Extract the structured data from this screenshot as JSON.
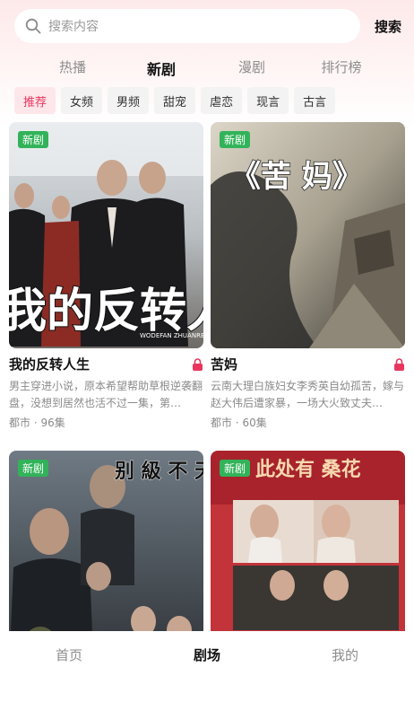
{
  "search": {
    "placeholder": "搜索内容",
    "button_label": "搜索"
  },
  "tabs": [
    {
      "label": "热播"
    },
    {
      "label": "新剧"
    },
    {
      "label": "漫剧"
    },
    {
      "label": "排行榜"
    }
  ],
  "active_tab": "新剧",
  "chips": [
    {
      "label": "推荐"
    },
    {
      "label": "女频"
    },
    {
      "label": "男频"
    },
    {
      "label": "甜宠"
    },
    {
      "label": "虐恋"
    },
    {
      "label": "现言"
    },
    {
      "label": "古言"
    }
  ],
  "active_chip": "推荐",
  "badge_text": "新剧",
  "cards": [
    {
      "badge": "新剧",
      "title": "我的反转人生",
      "description": "男主穿进小说，原本希望帮助草根逆袭翻盘，没想到居然也活不过一集，第…",
      "meta": "都市 · 96集",
      "poster_text": "我的反转人",
      "poster_subtext": "WODEFAN ZHUANRENSH"
    },
    {
      "badge": "新剧",
      "title": "苦妈",
      "description": "云南大理白族妇女李秀英自幼孤苦，嫁与赵大伟后遭家暴，一场大火致丈夫…",
      "meta": "都市 · 60集",
      "poster_text": "《苦 妈》"
    },
    {
      "badge": "新剧",
      "title": "",
      "description": "",
      "meta": "",
      "poster_text": "别 級 不 天 好 惹"
    },
    {
      "badge": "新剧",
      "title": "",
      "description": "",
      "meta": "",
      "poster_text": "此处有 桑花"
    }
  ],
  "bottom_nav": [
    {
      "label": "首页"
    },
    {
      "label": "剧场"
    },
    {
      "label": "我的"
    }
  ],
  "active_nav": "剧场",
  "colors": {
    "accent": "#e8365e",
    "badge_green": "#32b35a",
    "chip_bg": "#f3f3f3",
    "text_gray": "#8a8a8a"
  }
}
